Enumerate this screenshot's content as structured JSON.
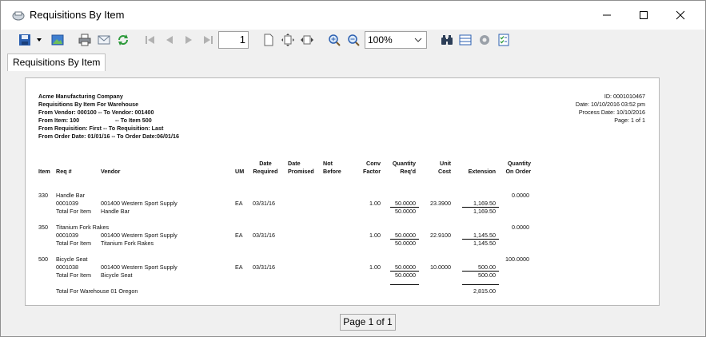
{
  "window": {
    "title": "Requisitions By Item"
  },
  "toolbar": {
    "page_value": "1",
    "zoom_value": "100%"
  },
  "tab": {
    "label": "Requisitions By Item"
  },
  "report": {
    "company": "Acme Manufacturing Company",
    "title": "Requisitions By Item For Warehouse",
    "filter_vendor": "From Vendor: 000100 -- To Vendor: 001400",
    "filter_item_from": "From Item: 100",
    "filter_item_to": "-- To Item 500",
    "filter_requisition": "From Requisition: First -- To Requisition: Last",
    "filter_order_date": "From Order Date: 01/01/16 -- To Order Date:06/01/16",
    "id": "ID: 0001010467",
    "date": "Date: 10/10/2016 03:52 pm",
    "process_date": "Process Date: 10/10/2016",
    "page": "Page: 1 of 1",
    "headers": {
      "item": "Item",
      "req": "Req #",
      "vendor": "Vendor",
      "um": "UM",
      "date1": "Date",
      "date2": "Required",
      "promised1": "Date",
      "promised2": "Promised",
      "notbefore1": "Not",
      "notbefore2": "Before",
      "conv1": "Conv",
      "conv2": "Factor",
      "qty1": "Quantity",
      "qty2": "Req'd",
      "unit1": "Unit",
      "unit2": "Cost",
      "ext": "Extension",
      "onorder1": "Quantity",
      "onorder2": "On Order"
    },
    "groups": [
      {
        "item": "330",
        "desc": "Handle Bar",
        "on_order": "0.0000",
        "req": "0001039",
        "vendor": "001400 Western Sport Supply",
        "um": "EA",
        "date_required": "03/31/16",
        "conv": "1.00",
        "qty": "50.0000",
        "unit_cost": "23.3900",
        "extension": "1,169.50",
        "total_label": "Total For Item",
        "total_desc": "Handle Bar",
        "total_qty": "50.0000",
        "total_ext": "1,169.50"
      },
      {
        "item": "350",
        "desc": "Titanium Fork Rakes",
        "on_order": "0.0000",
        "req": "0001039",
        "vendor": "001400 Western Sport Supply",
        "um": "EA",
        "date_required": "03/31/16",
        "conv": "1.00",
        "qty": "50.0000",
        "unit_cost": "22.9100",
        "extension": "1,145.50",
        "total_label": "Total For Item",
        "total_desc": "Titanium Fork Rakes",
        "total_qty": "50.0000",
        "total_ext": "1,145.50"
      },
      {
        "item": "500",
        "desc": "Bicycle Seat",
        "on_order": "100.0000",
        "req": "0001038",
        "vendor": "001400 Western Sport Supply",
        "um": "EA",
        "date_required": "03/31/16",
        "conv": "1.00",
        "qty": "50.0000",
        "unit_cost": "10.0000",
        "extension": "500.00",
        "total_label": "Total For Item",
        "total_desc": "Bicycle Seat",
        "total_qty": "50.0000",
        "total_ext": "500.00"
      }
    ],
    "warehouse_total_label": "Total For Warehouse 01 Oregon",
    "warehouse_total_ext": "2,815.00"
  },
  "status": {
    "page_text": "Page 1 of 1"
  },
  "icons": {
    "app": "printer-app-icon",
    "minimize": "minimize-icon",
    "maximize": "maximize-icon",
    "close": "close-icon",
    "save": "save-icon",
    "export": "image-export-icon",
    "print": "print-icon",
    "email": "email-icon",
    "refresh": "refresh-icon",
    "first": "first-page-icon",
    "prev": "prev-page-icon",
    "next": "next-page-icon",
    "last": "last-page-icon",
    "pagesetup": "page-setup-icon",
    "fitpage": "fit-page-icon",
    "fitwidth": "fit-width-icon",
    "zoomin": "zoom-in-icon",
    "zoomout": "zoom-out-icon",
    "find": "binoculars-icon",
    "layout": "layout-icon",
    "settings": "gear-icon",
    "options": "checklist-icon"
  }
}
